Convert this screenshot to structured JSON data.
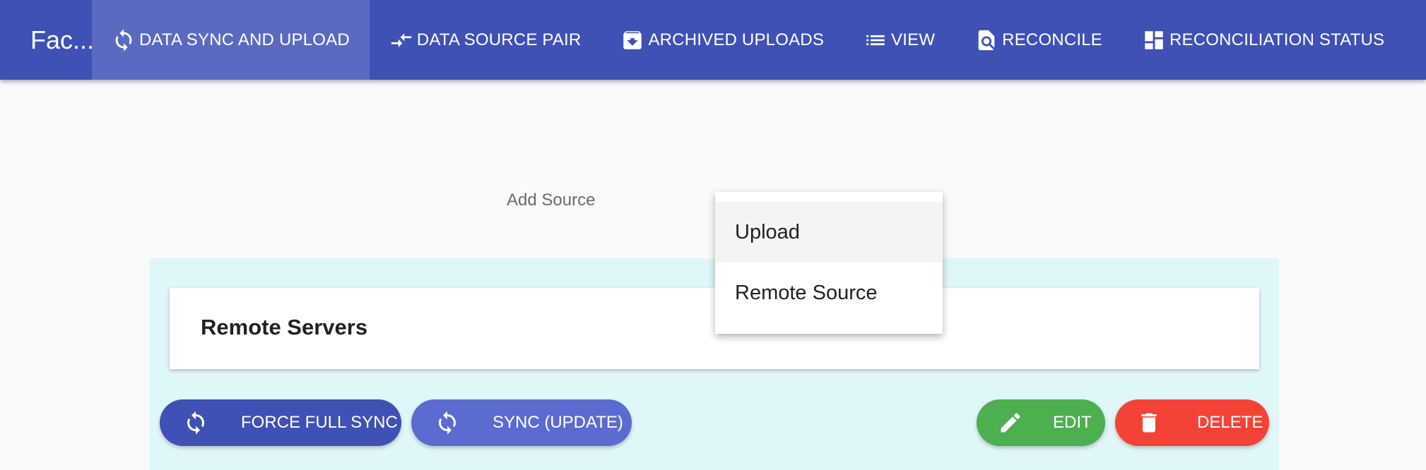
{
  "app": {
    "title": "Fac..."
  },
  "nav": {
    "items": [
      {
        "label": "DATA SYNC AND UPLOAD",
        "icon": "sync-icon"
      },
      {
        "label": "DATA SOURCE PAIR",
        "icon": "compare-arrows-icon"
      },
      {
        "label": "ARCHIVED UPLOADS",
        "icon": "archive-icon"
      },
      {
        "label": "VIEW",
        "icon": "list-icon"
      },
      {
        "label": "RECONCILE",
        "icon": "find-in-page-icon"
      },
      {
        "label": "RECONCILIATION STATUS",
        "icon": "dashboard-icon"
      }
    ]
  },
  "main": {
    "add_source_label": "Add Source",
    "card_title": "Remote Servers",
    "buttons": {
      "force_full_sync": "FORCE FULL SYNC",
      "sync_update": "SYNC (UPDATE)",
      "edit": "EDIT",
      "delete": "DELETE"
    }
  },
  "menu": {
    "items": [
      {
        "label": "Upload"
      },
      {
        "label": "Remote Source"
      }
    ]
  },
  "colors": {
    "appbar": "#3f51b5",
    "panel": "#e0f7fa",
    "force_sync": "#3f51b5",
    "sync_update": "#5c6bd0",
    "edit": "#4caf50",
    "delete": "#f44336"
  }
}
